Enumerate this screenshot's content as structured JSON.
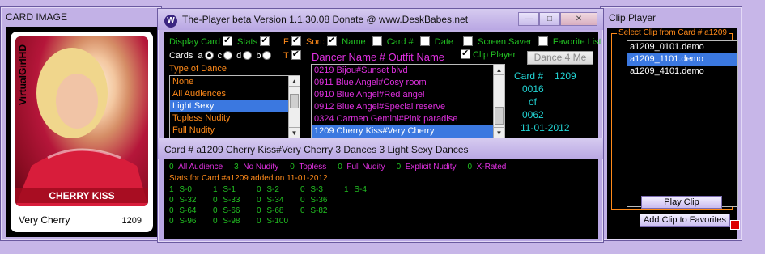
{
  "card_window": {
    "title": "CARD IMAGE",
    "brand": "VirtualGirlHD",
    "card_name_banner": "CHERRY KISS",
    "outfit": "Very Cherry",
    "card_number": "1209"
  },
  "clip_window": {
    "title": "Clip Player",
    "group_label": "Select Clip from Card # a1209",
    "clips": [
      {
        "label": "a1209_0101.demo",
        "selected": false
      },
      {
        "label": "a1209_1101.demo",
        "selected": true
      },
      {
        "label": "a1209_4101.demo",
        "selected": false
      }
    ],
    "play_label": "Play Clip",
    "add_fav_label": "Add Clip to Favorites"
  },
  "main_window": {
    "logo_letter": "W",
    "title": "The-Player beta  Version 1.1.30.08 Donate @ www.DeskBabes.net",
    "controls": {
      "minimize": "—",
      "maximize": "□",
      "close": "✕"
    },
    "display_card_label": "Display Card",
    "stats_label": "Stats",
    "f_label": "F",
    "t_label": "T",
    "sort_label": "Sort:",
    "name_label": "Name",
    "cardnum_label": "Card #",
    "date_label": "Date",
    "screensaver_label": "Screen Saver",
    "favlist_label": "Favorite List",
    "clip_player_label": "Clip Player",
    "cards_label": "Cards",
    "radio_a": "a",
    "radio_c": "c",
    "radio_d": "d",
    "radio_b": "b",
    "type_of_dance_label": "Type of Dance",
    "dance_types": [
      {
        "label": "None",
        "selected": false
      },
      {
        "label": "All Audiences",
        "selected": false
      },
      {
        "label": "Light Sexy",
        "selected": true
      },
      {
        "label": "Topless Nudity",
        "selected": false
      },
      {
        "label": "Full Nudity",
        "selected": false
      }
    ],
    "dancer_header": "Dancer Name # Outfit Name",
    "dance_button": "Dance 4 Me",
    "dancers": [
      {
        "label": "0219 Bijou#Sunset blvd",
        "selected": false
      },
      {
        "label": "0911 Blue Angel#Cosy room",
        "selected": false
      },
      {
        "label": "0910 Blue Angel#Red angel",
        "selected": false
      },
      {
        "label": "0912 Blue Angel#Special reserve",
        "selected": false
      },
      {
        "label": "0324 Carmen Gemini#Pink paradise",
        "selected": false
      },
      {
        "label": "1209 Cherry Kiss#Very Cherry",
        "selected": true
      }
    ],
    "info": {
      "card_label": "Card #",
      "card_value": "1209",
      "index": "0016",
      "of": "of",
      "total": "0062",
      "date": "11-01-2012"
    }
  },
  "stats_window": {
    "title": "Card # a1209 Cherry Kiss#Very Cherry 3 Dances 3 Light Sexy Dances",
    "categories": [
      {
        "count": "0",
        "label": "All Audience",
        "color": "#e030e0"
      },
      {
        "count": "3",
        "label": "No Nudity",
        "color": "#e030e0"
      },
      {
        "count": "0",
        "label": "Topless",
        "color": "#e030e0"
      },
      {
        "count": "0",
        "label": "Full Nudity",
        "color": "#e030e0"
      },
      {
        "count": "0",
        "label": "Explicit Nudity",
        "color": "#e030e0"
      },
      {
        "count": "0",
        "label": "X-Rated",
        "color": "#e030e0"
      }
    ],
    "added_line": "Stats for Card #a1209 added on 11-01-2012",
    "grid": [
      [
        {
          "c": "1",
          "s": "S-0"
        },
        {
          "c": "1",
          "s": "S-1"
        },
        {
          "c": "0",
          "s": "S-2"
        },
        {
          "c": "0",
          "s": "S-3"
        },
        {
          "c": "1",
          "s": "S-4"
        }
      ],
      [
        {
          "c": "0",
          "s": "S-32"
        },
        {
          "c": "0",
          "s": "S-33"
        },
        {
          "c": "0",
          "s": "S-34"
        },
        {
          "c": "0",
          "s": "S-36"
        }
      ],
      [
        {
          "c": "0",
          "s": "S-64"
        },
        {
          "c": "0",
          "s": "S-66"
        },
        {
          "c": "0",
          "s": "S-68"
        },
        {
          "c": "0",
          "s": "S-82"
        }
      ],
      [
        {
          "c": "0",
          "s": "S-96"
        },
        {
          "c": "0",
          "s": "S-98"
        },
        {
          "c": "0",
          "s": "S-100"
        }
      ]
    ]
  }
}
